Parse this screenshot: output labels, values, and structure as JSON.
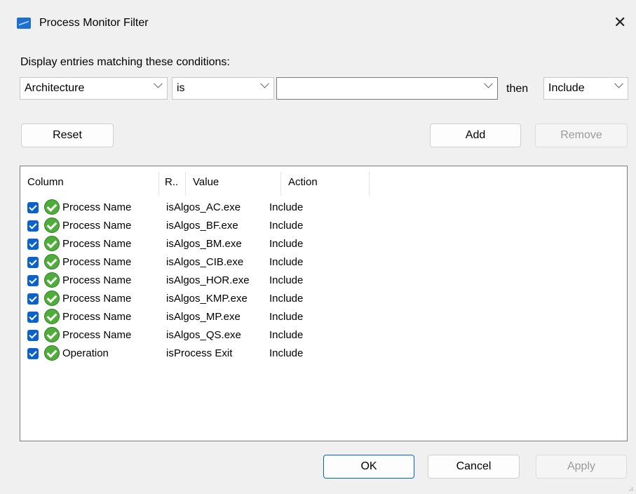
{
  "window": {
    "title": "Process Monitor Filter"
  },
  "caption": "Display entries matching these conditions:",
  "condition": {
    "column": "Architecture",
    "relation": "is",
    "value": "",
    "then_label": "then",
    "action": "Include"
  },
  "buttons": {
    "reset": "Reset",
    "add": "Add",
    "remove": "Remove",
    "ok": "OK",
    "cancel": "Cancel",
    "apply": "Apply"
  },
  "list": {
    "headers": [
      "Column",
      "R..",
      "Value",
      "Action"
    ],
    "rows": [
      {
        "column": "Process Name",
        "relation": "is",
        "value": "Algos_AC.exe",
        "action": "Include"
      },
      {
        "column": "Process Name",
        "relation": "is",
        "value": "Algos_BF.exe",
        "action": "Include"
      },
      {
        "column": "Process Name",
        "relation": "is",
        "value": "Algos_BM.exe",
        "action": "Include"
      },
      {
        "column": "Process Name",
        "relation": "is",
        "value": "Algos_CIB.exe",
        "action": "Include"
      },
      {
        "column": "Process Name",
        "relation": "is",
        "value": "Algos_HOR.exe",
        "action": "Include"
      },
      {
        "column": "Process Name",
        "relation": "is",
        "value": "Algos_KMP.exe",
        "action": "Include"
      },
      {
        "column": "Process Name",
        "relation": "is",
        "value": "Algos_MP.exe",
        "action": "Include"
      },
      {
        "column": "Process Name",
        "relation": "is",
        "value": "Algos_QS.exe",
        "action": "Include"
      },
      {
        "column": "Operation",
        "relation": "is",
        "value": "Process Exit",
        "action": "Include"
      }
    ]
  },
  "colors": {
    "accent": "#0b63c9",
    "ok_green": "#4fae3a"
  }
}
